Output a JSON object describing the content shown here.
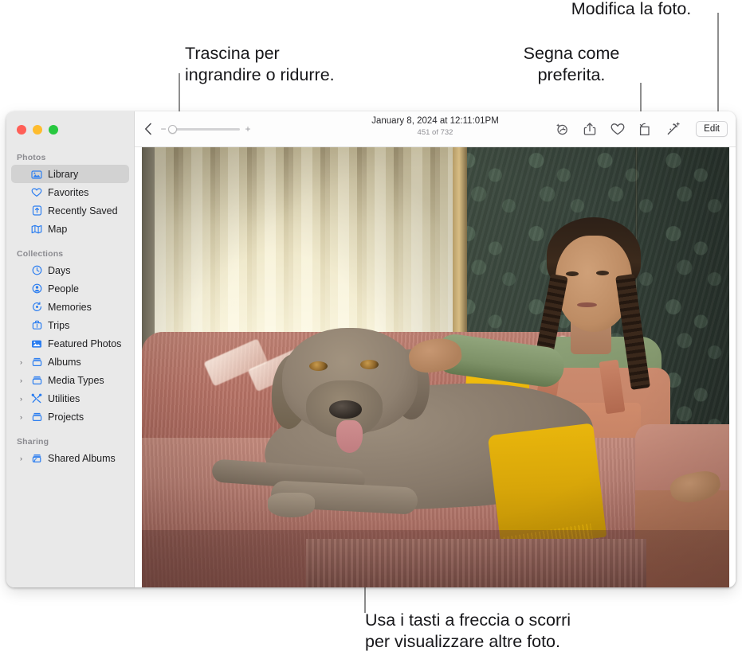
{
  "callouts": {
    "zoom": "Trascina per\ningrandire o ridurre.",
    "edit": "Modifica la foto.",
    "favorite": "Segna come\npreferita.",
    "browse": "Usa i tasti a freccia o scorri\nper visualizzare altre foto."
  },
  "window": {
    "traffic_lights": [
      {
        "name": "close",
        "color": "#ff5f57"
      },
      {
        "name": "minimize",
        "color": "#febc2e"
      },
      {
        "name": "zoom",
        "color": "#28c840"
      }
    ]
  },
  "sidebar": {
    "sections": [
      {
        "title": "Photos",
        "items": [
          {
            "label": "Library",
            "icon": "photo-library-icon",
            "selected": true,
            "disclosure": false
          },
          {
            "label": "Favorites",
            "icon": "heart-icon",
            "selected": false,
            "disclosure": false
          },
          {
            "label": "Recently Saved",
            "icon": "recently-saved-icon",
            "selected": false,
            "disclosure": false
          },
          {
            "label": "Map",
            "icon": "map-icon",
            "selected": false,
            "disclosure": false
          }
        ]
      },
      {
        "title": "Collections",
        "items": [
          {
            "label": "Days",
            "icon": "clock-icon",
            "selected": false,
            "disclosure": false
          },
          {
            "label": "People",
            "icon": "person-circle-icon",
            "selected": false,
            "disclosure": false
          },
          {
            "label": "Memories",
            "icon": "memories-icon",
            "selected": false,
            "disclosure": false
          },
          {
            "label": "Trips",
            "icon": "suitcase-icon",
            "selected": false,
            "disclosure": false
          },
          {
            "label": "Featured Photos",
            "icon": "featured-photo-icon",
            "selected": false,
            "disclosure": false
          },
          {
            "label": "Albums",
            "icon": "album-icon",
            "selected": false,
            "disclosure": true
          },
          {
            "label": "Media Types",
            "icon": "album-icon",
            "selected": false,
            "disclosure": true
          },
          {
            "label": "Utilities",
            "icon": "utilities-icon",
            "selected": false,
            "disclosure": true
          },
          {
            "label": "Projects",
            "icon": "album-icon",
            "selected": false,
            "disclosure": true
          }
        ]
      },
      {
        "title": "Sharing",
        "items": [
          {
            "label": "Shared Albums",
            "icon": "shared-album-icon",
            "selected": false,
            "disclosure": true
          }
        ]
      }
    ]
  },
  "toolbar": {
    "back_icon": "chevron-left-icon",
    "zoom": {
      "minus_label": "−",
      "plus_label": "+",
      "value_percent": 12
    },
    "title": "January 8, 2024 at 12:11:01PM",
    "subtitle": "451 of 732",
    "actions": [
      {
        "name": "info-sparkle-icon",
        "label": "Info"
      },
      {
        "name": "share-icon",
        "label": "Share"
      },
      {
        "name": "heart-icon",
        "label": "Favorite"
      },
      {
        "name": "rotate-icon",
        "label": "Rotate"
      },
      {
        "name": "magic-wand-icon",
        "label": "Auto Enhance"
      }
    ],
    "edit_label": "Edit"
  },
  "photo": {
    "description": "Girl in green shirt and pink corduroy overalls petting a grey Weimaraner dog on a pink sofa with a yellow throw blanket, vertical blinds on the left and dark green damask wallpaper on the right."
  },
  "colors": {
    "accent_blue": "#2c7ef0",
    "sidebar_bg": "#e9e9e9",
    "selection_bg": "#d2d2d2",
    "leader_line": "#8e8e8e",
    "callout_text": "#17171a"
  }
}
